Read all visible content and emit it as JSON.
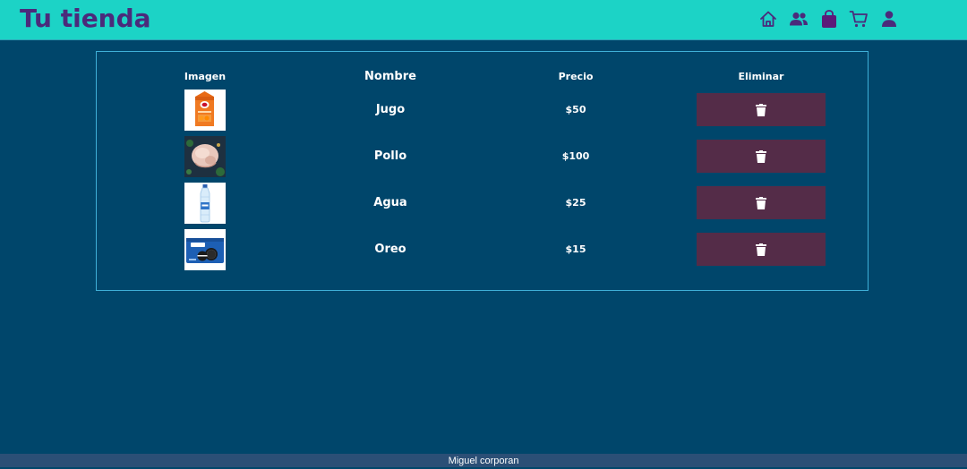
{
  "navbar": {
    "brand": "Tu tienda",
    "icons": [
      "home-icon",
      "users-icon",
      "shopping-bag-icon",
      "cart-icon",
      "user-icon"
    ],
    "bg_color": "#1cd3c6",
    "brand_color": "#4b2a7b"
  },
  "table": {
    "headers": {
      "image": "Imagen",
      "name": "Nombre",
      "price": "Precio",
      "delete": "Eliminar"
    },
    "rows": [
      {
        "name": "Jugo",
        "price": "$50",
        "image": "juice-carton-image"
      },
      {
        "name": "Pollo",
        "price": "$100",
        "image": "raw-chicken-image"
      },
      {
        "name": "Agua",
        "price": "$25",
        "image": "water-bottle-image"
      },
      {
        "name": "Oreo",
        "price": "$15",
        "image": "oreo-package-image"
      }
    ],
    "delete_icon": "trash-icon",
    "delete_button_color": "#542c48"
  },
  "footer": {
    "text": "Miguel corporan"
  },
  "colors": {
    "page_bg": "#00466b",
    "panel_border": "#3fb0d8"
  }
}
